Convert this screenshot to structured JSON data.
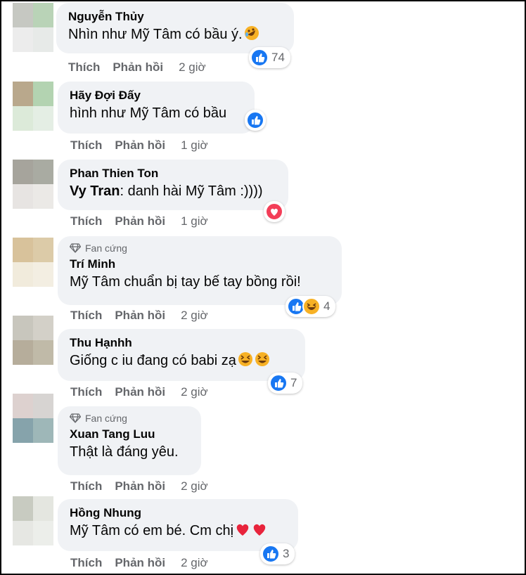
{
  "comments": [
    {
      "name": "Nguyễn Thủy",
      "text": "Nhìn như Mỹ Tâm có bầu ý.",
      "action_like": "Thích",
      "action_reply": "Phản hồi",
      "time": "2 giờ",
      "reaction_count": "74",
      "avatar_colors": [
        "#c6c8c2",
        "#b9d3b7",
        "#ececec",
        "#e7eae8"
      ]
    },
    {
      "name": "Hãy Đợi Đấy",
      "text": "hình như Mỹ Tâm có bầu",
      "action_like": "Thích",
      "action_reply": "Phản hồi",
      "time": "1 giờ",
      "avatar_colors": [
        "#b9a88c",
        "#b3d3b1",
        "#dcead9",
        "#e4eee4"
      ]
    },
    {
      "name": "Phan Thien Ton",
      "mention": "Vy Tran",
      "text": ": danh hài Mỹ Tâm :))))",
      "action_like": "Thích",
      "action_reply": "Phản hồi",
      "time": "1 giờ",
      "avatar_colors": [
        "#a6a49c",
        "#a9aba2",
        "#e7e4e2",
        "#ebe9e6"
      ]
    },
    {
      "badge": "Fan cứng",
      "name": "Trí Minh",
      "text": "Mỹ Tâm chuẩn bị tay bế tay bồng rồi!",
      "action_like": "Thích",
      "action_reply": "Phản hồi",
      "time": "2 giờ",
      "reaction_count": "4",
      "avatar_colors": [
        "#d8c29b",
        "#dccba8",
        "#f1ebdc",
        "#f3eee2"
      ]
    },
    {
      "name": "Thu Hạnhh",
      "text": "Giống c iu đang có babi zạ",
      "action_like": "Thích",
      "action_reply": "Phản hồi",
      "time": "2 giờ",
      "reaction_count": "7",
      "avatar_colors": [
        "#c8c6bd",
        "#d3d0c8",
        "#b6ad9b",
        "#c0baa8"
      ]
    },
    {
      "badge": "Fan cứng",
      "name": "Xuan Tang Luu",
      "text": "Thật là đáng yêu.",
      "action_like": "Thích",
      "action_reply": "Phản hồi",
      "time": "2 giờ",
      "avatar_colors": [
        "#ddd1cf",
        "#d7d4d2",
        "#86a3ab",
        "#9eb7b8"
      ]
    },
    {
      "name": "Hồng Nhung",
      "text": "Mỹ Tâm có em bé. Cm chị",
      "action_like": "Thích",
      "action_reply": "Phản hồi",
      "time": "2 giờ",
      "reaction_count": "3",
      "avatar_colors": [
        "#c8cbc1",
        "#e4e6e0",
        "#e6e7e3",
        "#eceeea"
      ]
    }
  ],
  "colors": {
    "bubble": "#f0f2f5",
    "like_blue": "#1877f2",
    "love_red": "#f33e58",
    "haha_yellow": "#f7b125",
    "meta_text": "#65676b"
  }
}
